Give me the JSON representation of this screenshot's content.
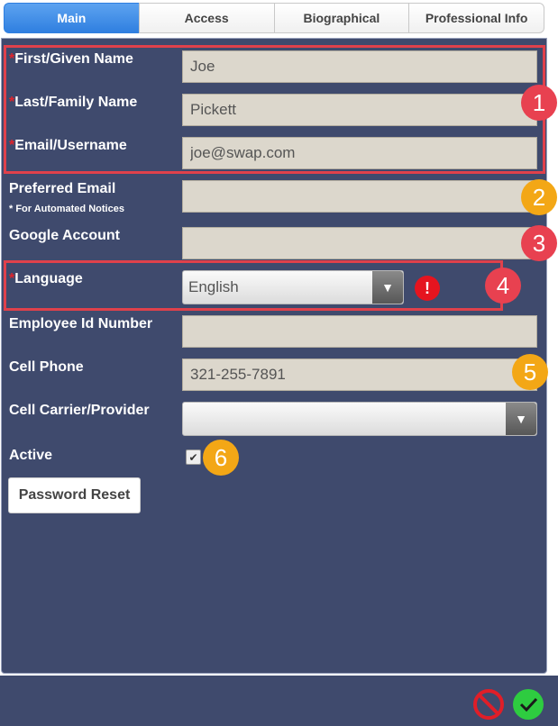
{
  "tabs": [
    "Main",
    "Access",
    "Biographical",
    "Professional Info"
  ],
  "fields": {
    "first_name": {
      "required": "*",
      "label": "First/Given Name",
      "value": "Joe"
    },
    "last_name": {
      "required": "*",
      "label": "Last/Family Name",
      "value": "Pickett"
    },
    "email": {
      "required": "*",
      "label": "Email/Username",
      "value": "joe@swap.com"
    },
    "preferred_email": {
      "label": "Preferred Email",
      "note": "* For Automated Notices",
      "value": ""
    },
    "google_account": {
      "label": "Google Account",
      "value": ""
    },
    "language": {
      "required": "*",
      "label": "Language",
      "value": "English"
    },
    "employee_id": {
      "label": "Employee Id Number",
      "value": ""
    },
    "cell_phone": {
      "label": "Cell Phone",
      "value": "321-255-7891"
    },
    "cell_carrier": {
      "label": "Cell Carrier/Provider",
      "value": ""
    },
    "active": {
      "label": "Active",
      "checked": true
    }
  },
  "buttons": {
    "password_reset": "Password Reset"
  },
  "badges": [
    "1",
    "2",
    "3",
    "4",
    "5",
    "6"
  ],
  "colors": {
    "panel": "#3f4a6d",
    "active_tab": "#2f7fe0",
    "highlight": "#e0414b",
    "badge_red": "#e84150",
    "badge_orange": "#f3a716"
  }
}
